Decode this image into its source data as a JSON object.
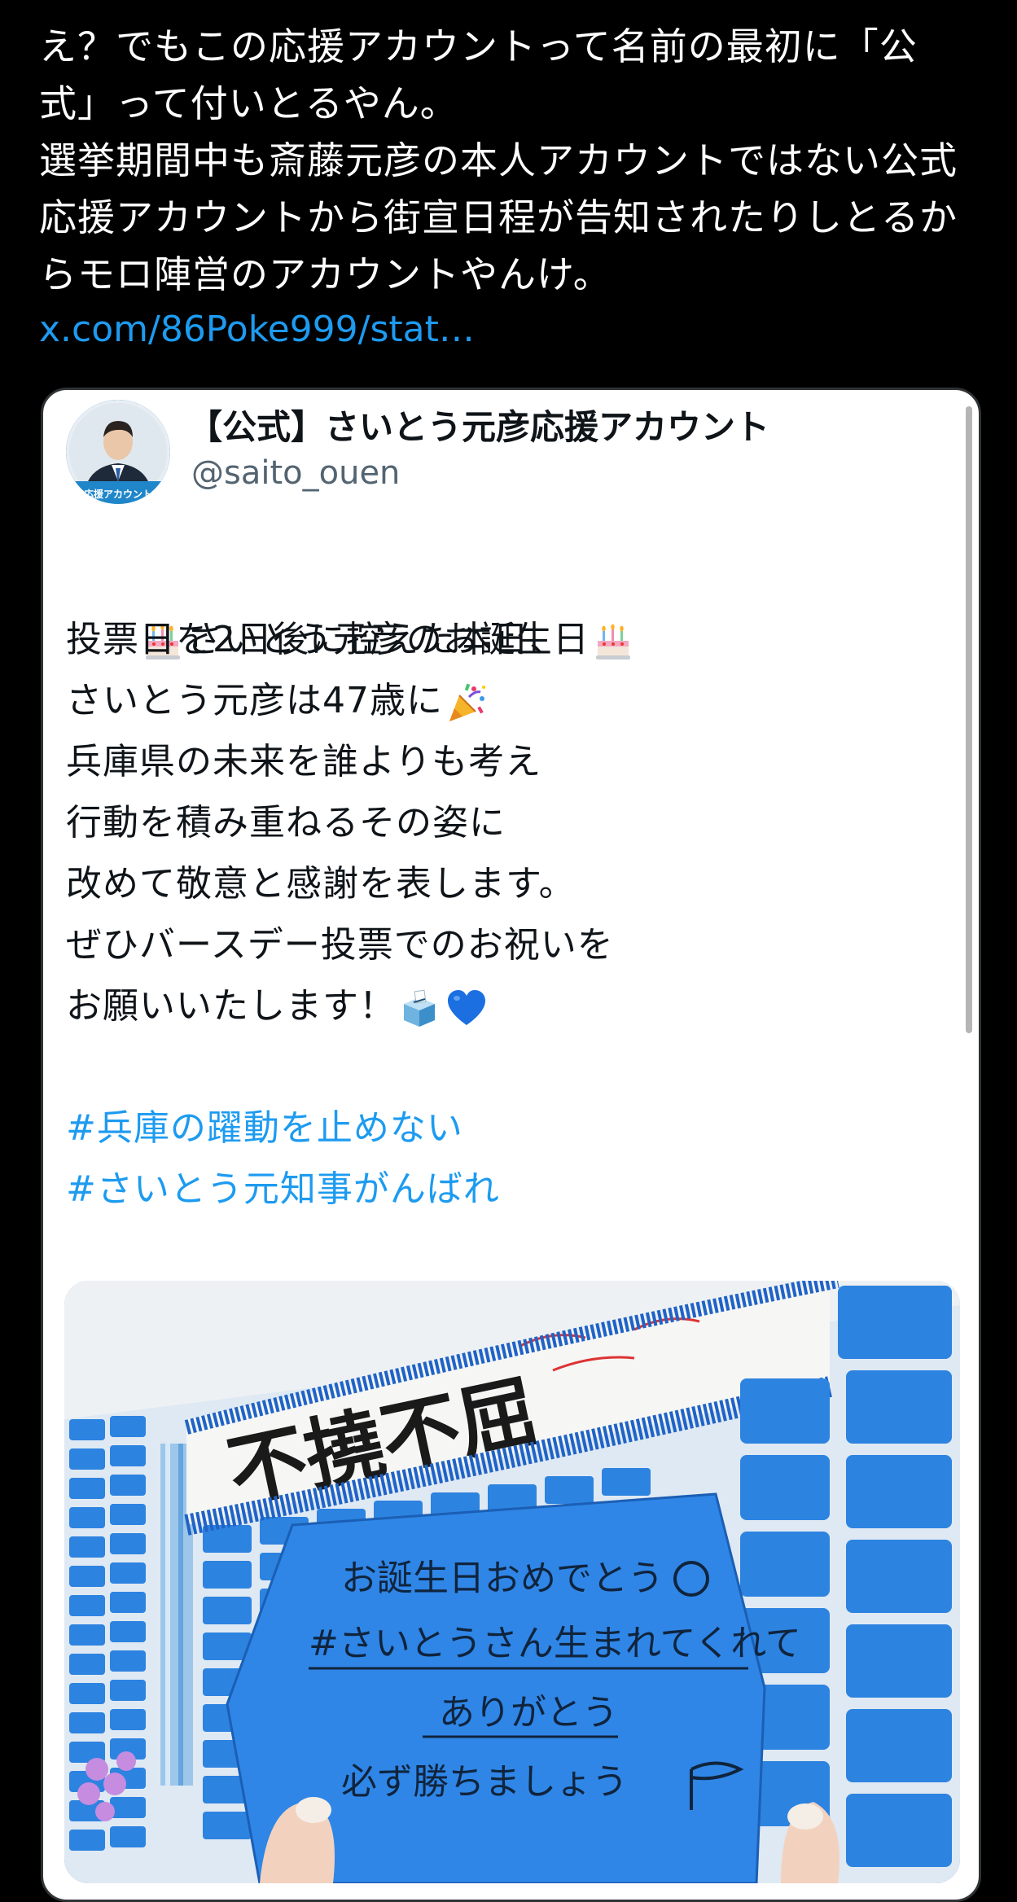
{
  "tweet": {
    "lines": [
      "え？でもこの応援アカウントって名前の最初に「公",
      "式」って付いとるやん。",
      "選挙期間中も斎藤元彦の本人アカウントではない公式",
      "応援アカウントから街宣日程が告知されたりしとるか",
      "らモロ陣営のアカウントやんけ。"
    ],
    "link": "x.com/86Poke999/stat…"
  },
  "quote": {
    "display_name": "【公式】さいとう元彦応援アカウント",
    "handle": "@saito_ouen",
    "avatar_badge": "応援アカウント",
    "body": {
      "line1": "さいとう元彦のお誕生日",
      "line2": "投票日を2日後に控えた本日、",
      "line3": "さいとう元彦は47歳に",
      "line4": "兵庫県の未来を誰よりも考え",
      "line5": "行動を積み重ねるその姿に",
      "line6": "改めて敬意と感謝を表します。",
      "line7": "ぜひバースデー投票でのお祝いを",
      "line8": "お願いいたします！"
    },
    "hashtags": [
      "#兵庫の躍動を止めない",
      "#さいとう元知事がんばれ"
    ],
    "emoji_icons": [
      "birthday-cake-icon",
      "party-popper-icon",
      "ballot-box-icon",
      "blue-heart-icon"
    ],
    "photo": {
      "banner_text": "不撓不屈",
      "card_lines": [
        "お誕生日おめでとう",
        "#さいとうさん生まれてくれて",
        "ありがとう",
        "必ず勝ちましょう"
      ]
    }
  },
  "colors": {
    "background": "#000000",
    "link": "#1d9bf0",
    "card_bg": "#ffffff",
    "handle": "#536471",
    "note_blue": "#2d83e0"
  }
}
